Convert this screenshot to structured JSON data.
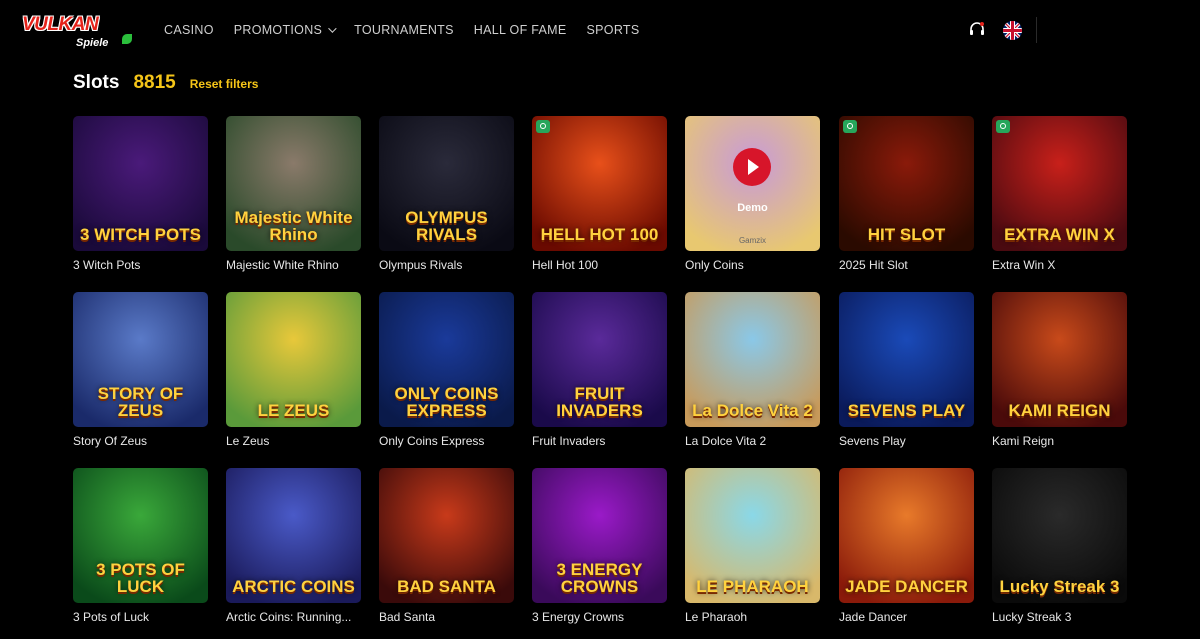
{
  "header": {
    "logo_main": "VULKAN",
    "logo_sub": "Spiele",
    "nav": [
      {
        "label": "CASINO"
      },
      {
        "label": "PROMOTIONS"
      },
      {
        "label": "TOURNAMENTS"
      },
      {
        "label": "HALL OF FAME"
      },
      {
        "label": "SPORTS"
      }
    ]
  },
  "section": {
    "title": "Slots",
    "count": "8815",
    "reset_label": "Reset filters"
  },
  "games": [
    {
      "name": "3 Witch Pots",
      "art": "3 WITCH POTS",
      "bg": "#4a1a7a",
      "bg2": "#1a0a3a",
      "badge": false
    },
    {
      "name": "Majestic White Rhino",
      "art": "Majestic White Rhino",
      "bg": "#8a7a6a",
      "bg2": "#2a4a2a",
      "badge": false
    },
    {
      "name": "Olympus Rivals",
      "art": "OLYMPUS RIVALS",
      "bg": "#2a2a3a",
      "bg2": "#0a0a14",
      "badge": false
    },
    {
      "name": "Hell Hot 100",
      "art": "HELL HOT 100",
      "bg": "#e8501a",
      "bg2": "#6a0a00",
      "badge": true
    },
    {
      "name": "Only Coins",
      "art": "",
      "bg": "#c89ad8",
      "bg2": "#e8c870",
      "badge": false,
      "demo": true
    },
    {
      "name": "2025 Hit Slot",
      "art": "HIT SLOT",
      "bg": "#8a1a0a",
      "bg2": "#2a0a00",
      "badge": true
    },
    {
      "name": "Extra Win X",
      "art": "EXTRA WIN X",
      "bg": "#c8201a",
      "bg2": "#4a0a10",
      "badge": true
    },
    {
      "name": "Story Of Zeus",
      "art": "STORY OF ZEUS",
      "bg": "#5a7ac8",
      "bg2": "#1a2a6a",
      "badge": false
    },
    {
      "name": "Le Zeus",
      "art": "LE ZEUS",
      "bg": "#e8c83a",
      "bg2": "#5a9a3a",
      "badge": false
    },
    {
      "name": "Only Coins Express",
      "art": "ONLY COINS EXPRESS",
      "bg": "#1a3a9a",
      "bg2": "#0a1a4a",
      "badge": false
    },
    {
      "name": "Fruit Invaders",
      "art": "FRUIT INVADERS",
      "bg": "#5a2a9a",
      "bg2": "#1a0a4a",
      "badge": false
    },
    {
      "name": "La Dolce Vita 2",
      "art": "La Dolce Vita 2",
      "bg": "#8ac8e8",
      "bg2": "#c89a5a",
      "badge": false
    },
    {
      "name": "Sevens Play",
      "art": "SEVENS PLAY",
      "bg": "#1a4ab8",
      "bg2": "#0a1a5a",
      "badge": false
    },
    {
      "name": "Kami Reign",
      "art": "KAMI REIGN",
      "bg": "#c84a1a",
      "bg2": "#4a0a0a",
      "badge": false
    },
    {
      "name": "3 Pots of Luck",
      "art": "3 POTS OF LUCK",
      "bg": "#3aa83a",
      "bg2": "#0a4a1a",
      "badge": false
    },
    {
      "name": "Arctic Coins: Running...",
      "art": "ARCTIC COINS",
      "bg": "#4a5ac8",
      "bg2": "#1a1a5a",
      "badge": false
    },
    {
      "name": "Bad Santa",
      "art": "BAD SANTA",
      "bg": "#c83a1a",
      "bg2": "#3a0a0a",
      "badge": false
    },
    {
      "name": "3 Energy Crowns",
      "art": "3 ENERGY CROWNS",
      "bg": "#9a1ac8",
      "bg2": "#3a0a5a",
      "badge": false
    },
    {
      "name": "Le Pharaoh",
      "art": "LE PHARAOH",
      "bg": "#8ad8e8",
      "bg2": "#d8b86a",
      "badge": false
    },
    {
      "name": "Jade Dancer",
      "art": "JADE DANCER",
      "bg": "#e87a2a",
      "bg2": "#8a1a0a",
      "badge": false
    },
    {
      "name": "Lucky Streak 3",
      "art": "Lucky Streak 3",
      "bg": "#2a2a2a",
      "bg2": "#0a0a0a",
      "badge": false
    }
  ],
  "demo": {
    "label": "Demo",
    "footer": "Gamzix"
  }
}
